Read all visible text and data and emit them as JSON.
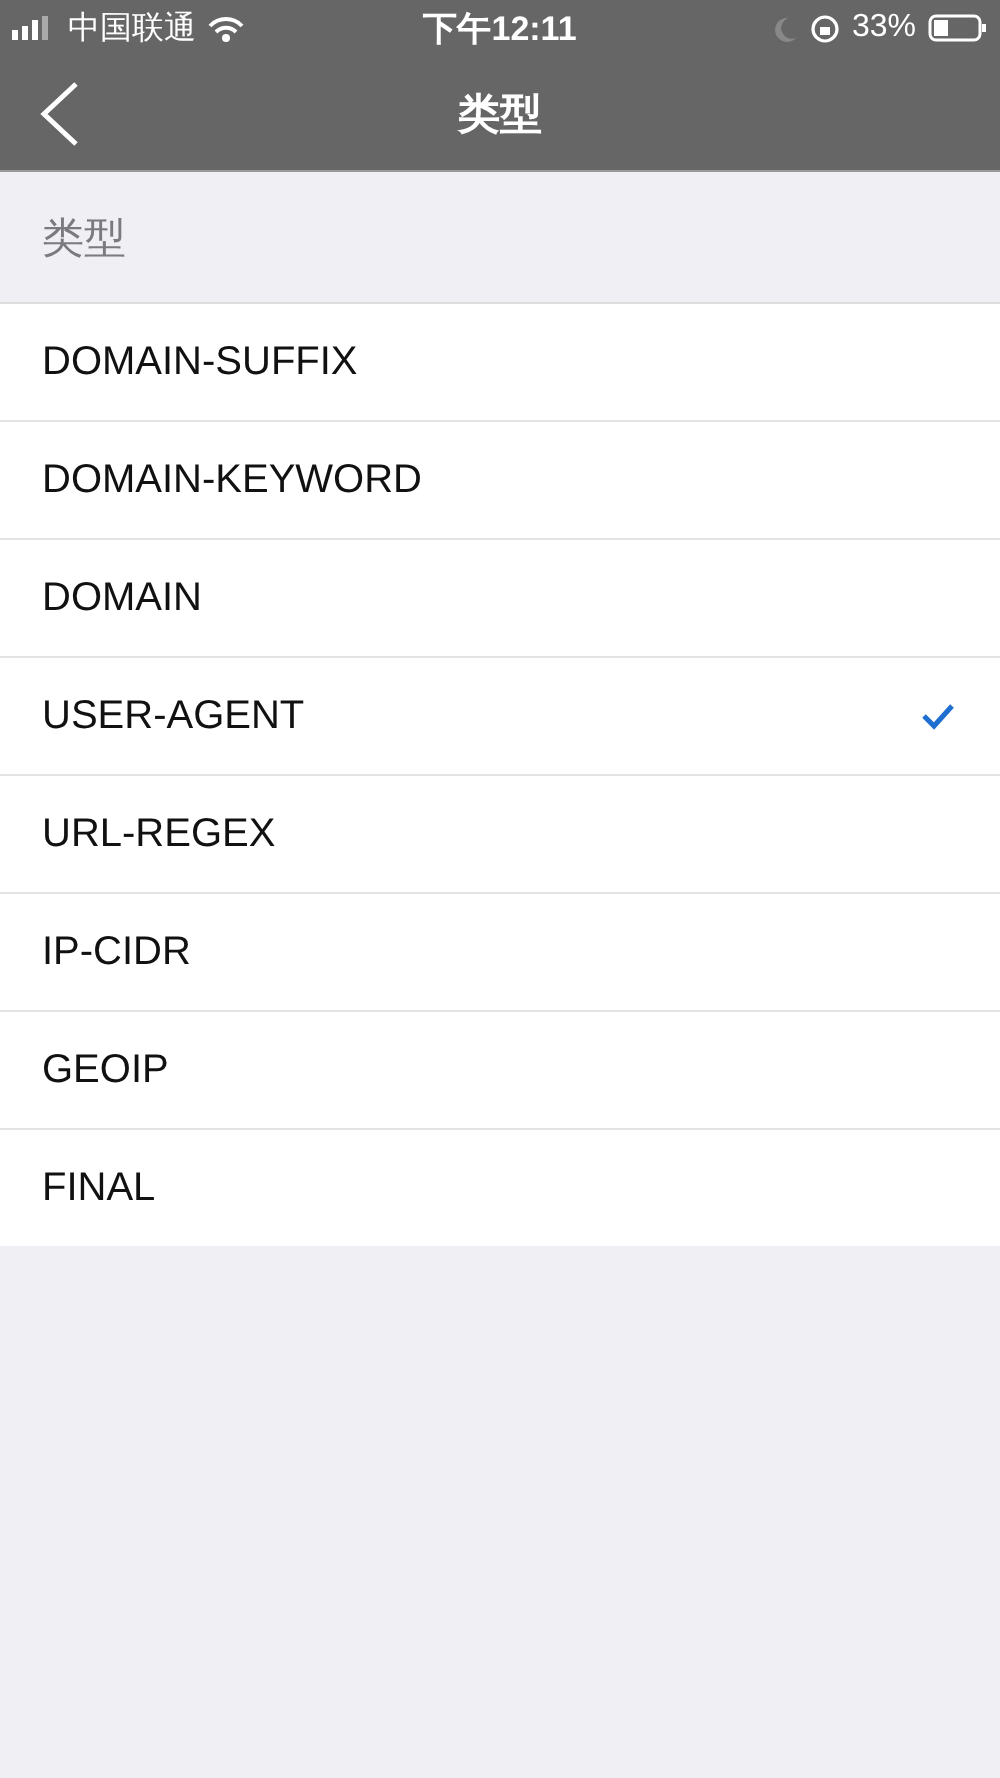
{
  "status_bar": {
    "carrier": "中国联通",
    "time": "下午12:11",
    "battery": "33%"
  },
  "nav": {
    "title": "类型"
  },
  "section": {
    "header": "类型"
  },
  "options": [
    {
      "label": "DOMAIN-SUFFIX",
      "selected": false
    },
    {
      "label": "DOMAIN-KEYWORD",
      "selected": false
    },
    {
      "label": "DOMAIN",
      "selected": false
    },
    {
      "label": "USER-AGENT",
      "selected": true
    },
    {
      "label": "URL-REGEX",
      "selected": false
    },
    {
      "label": "IP-CIDR",
      "selected": false
    },
    {
      "label": "GEOIP",
      "selected": false
    },
    {
      "label": "FINAL",
      "selected": false
    }
  ]
}
